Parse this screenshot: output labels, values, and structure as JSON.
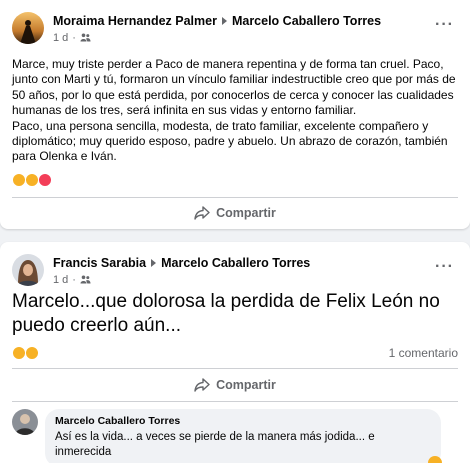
{
  "post1": {
    "author": "Moraima Hernandez Palmer",
    "target": "Marcelo Caballero Torres",
    "time": "1 d",
    "body": "Marce, muy triste perder a Paco de manera repentina y de forma tan cruel. Paco, junto con Marti y tú, formaron un vínculo familiar indestructible creo que por más de 50 años, por lo que está perdida, por conocerlos de cerca y conocer las cualidades humanas de los tres, será infinita en sus vidas y entorno familiar.",
    "body2": "Paco, una persona sencilla, modesta, de trato familiar, excelente compañero y diplomático; muy querido esposo, padre y abuelo. Un abrazo de corazón, también para Olenka e Iván.",
    "share_label": "Compartir",
    "reactions": [
      "sad-icon",
      "care-icon",
      "love-icon"
    ]
  },
  "post2": {
    "author": "Francis Sarabia",
    "target": "Marcelo Caballero Torres",
    "time": "1 d",
    "body": "Marcelo...que dolorosa la perdida de Felix León no puedo creerlo aún...",
    "comment_count": "1 comentario",
    "share_label": "Compartir",
    "reactions": [
      "sad-icon",
      "wow-icon"
    ]
  },
  "comment": {
    "author": "Marcelo Caballero Torres",
    "text": "Así es la vida... a veces se pierde de la manera más jodida... e inmerecida"
  },
  "colors": {
    "secondary_text": "#65676b",
    "divider": "#ced0d4",
    "bubble": "#f0f2f5"
  }
}
